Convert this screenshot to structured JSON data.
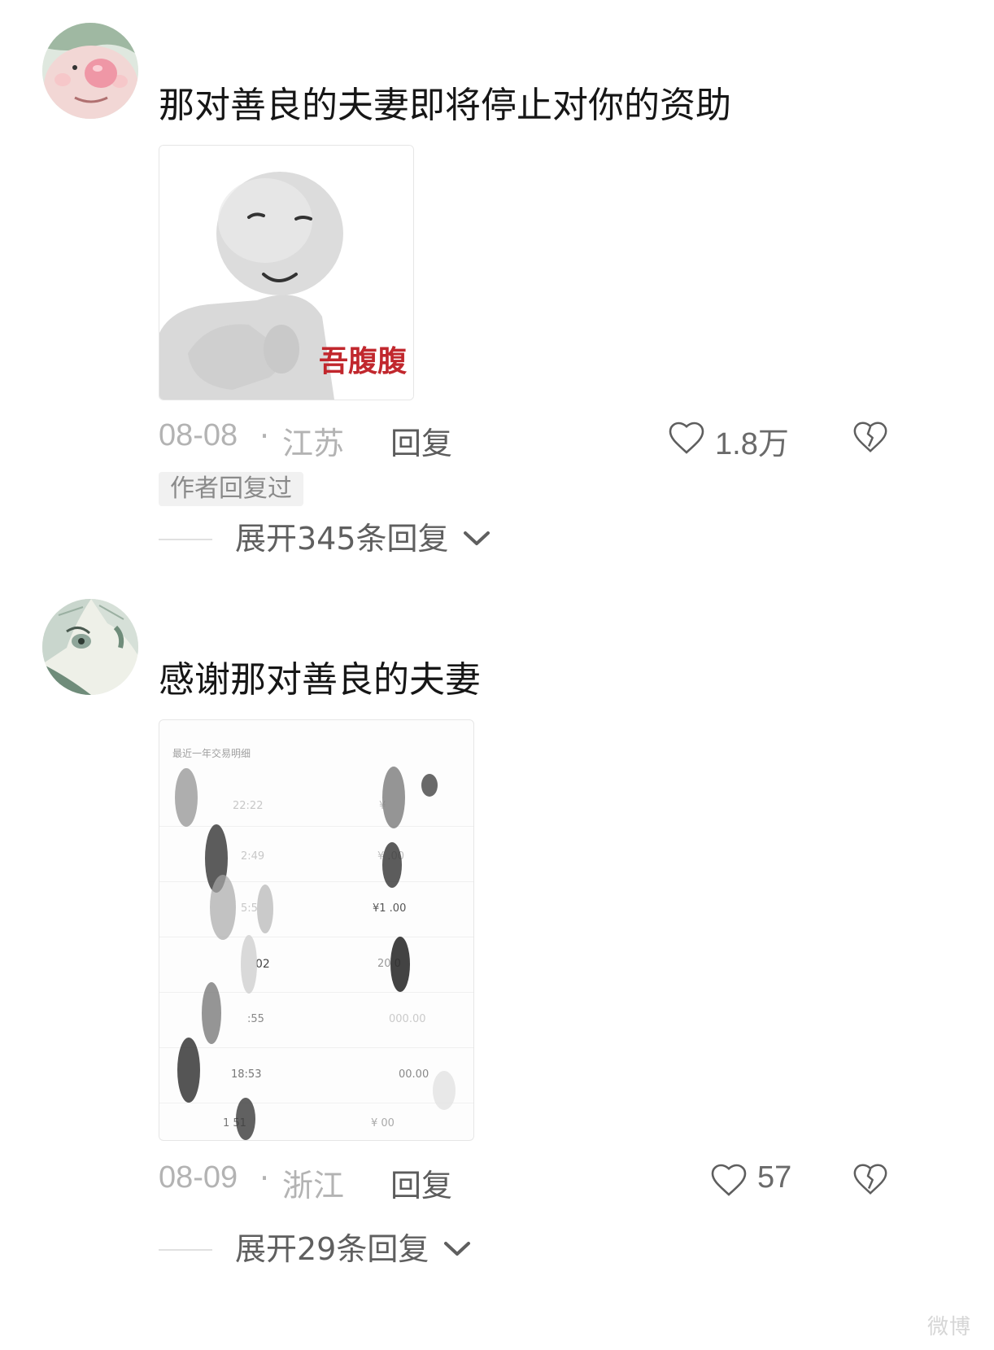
{
  "comments": [
    {
      "text": "那对善良的夫妻即将停止对你的资助",
      "image_caption": "吾腹腹",
      "date": "08-08",
      "region": "江苏",
      "reply_label": "回复",
      "like_count": "1.8万",
      "author_badge": "作者回复过",
      "expand_label": "展开345条回复"
    },
    {
      "text": "感谢那对善良的夫妻",
      "image_header": "最近一年交易明细",
      "transaction_rows": [
        {
          "time": "22:22",
          "amount": "¥"
        },
        {
          "time": "2:49",
          "amount": "¥ .00"
        },
        {
          "time": "5:5",
          "amount": "¥1 .00"
        },
        {
          "time": "02",
          "amount": "20 0"
        },
        {
          "time": ":55",
          "amount": "000.00"
        },
        {
          "time": "18:53",
          "amount": "00.00"
        },
        {
          "time": "1 51",
          "amount": "¥ 00"
        }
      ],
      "date": "08-09",
      "region": "浙江",
      "reply_label": "回复",
      "like_count": "57",
      "expand_label": "展开29条回复"
    }
  ],
  "meta_separator": "·",
  "watermark": "微博",
  "colors": {
    "text_primary": "#161616",
    "text_meta": "#b3b3b3",
    "badge_bg": "#f1f1f1"
  },
  "icons": {
    "like": "heart-outline-icon",
    "dislike": "broken-heart-icon",
    "expand": "chevron-down-icon"
  }
}
